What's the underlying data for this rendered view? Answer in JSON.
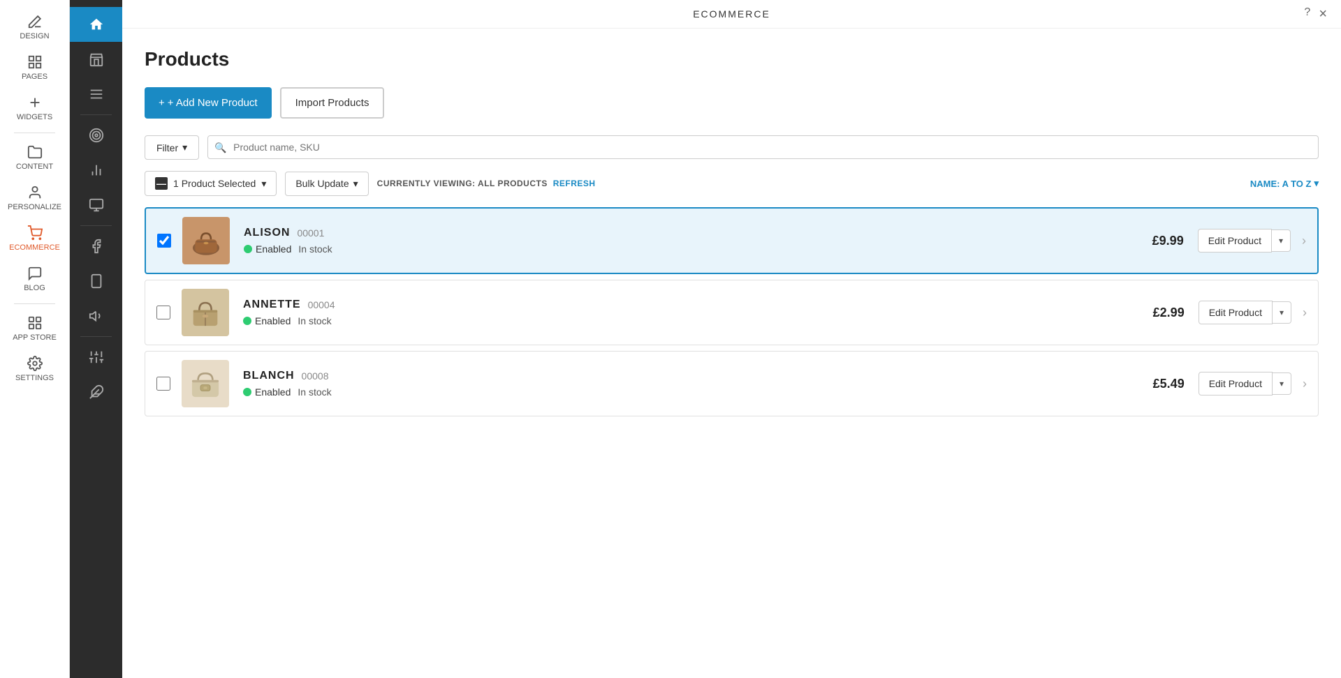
{
  "app_title": "ECOMMERCE",
  "far_left_sidebar": {
    "items": [
      {
        "id": "design",
        "label": "DESIGN",
        "icon": "pencil-icon",
        "active": false
      },
      {
        "id": "pages",
        "label": "PAGES",
        "icon": "pages-icon",
        "active": false
      },
      {
        "id": "widgets",
        "label": "WIDGETS",
        "icon": "plus-icon",
        "active": false
      },
      {
        "id": "content",
        "label": "CONTENT",
        "icon": "folder-icon",
        "active": false
      },
      {
        "id": "personalize",
        "label": "PERSONALIZE",
        "icon": "person-icon",
        "active": false
      },
      {
        "id": "ecommerce",
        "label": "ECOMMERCE",
        "icon": "cart-icon",
        "active": true
      },
      {
        "id": "blog",
        "label": "BLOG",
        "icon": "chat-icon",
        "active": false
      },
      {
        "id": "app-store",
        "label": "APP STORE",
        "icon": "puzzle-icon",
        "active": false
      },
      {
        "id": "settings",
        "label": "SETTINGS",
        "icon": "gear-icon",
        "active": false
      }
    ]
  },
  "inner_sidebar": {
    "items": [
      {
        "id": "home",
        "icon": "home-icon",
        "active": true
      },
      {
        "id": "store",
        "icon": "store-icon",
        "active": false
      },
      {
        "id": "menu",
        "icon": "menu-icon",
        "active": false
      },
      {
        "id": "target",
        "icon": "target-icon",
        "active": false
      },
      {
        "id": "chart",
        "icon": "chart-icon",
        "active": false
      },
      {
        "id": "orders",
        "icon": "orders-icon",
        "active": false
      },
      {
        "id": "social",
        "icon": "social-icon",
        "active": false
      },
      {
        "id": "mobile",
        "icon": "mobile-icon",
        "active": false
      },
      {
        "id": "megaphone",
        "icon": "megaphone-icon",
        "active": false
      },
      {
        "id": "extensions",
        "icon": "extensions-icon",
        "active": false
      },
      {
        "id": "sliders",
        "icon": "sliders-icon",
        "active": false
      },
      {
        "id": "puzzle2",
        "icon": "puzzle2-icon",
        "active": false
      }
    ]
  },
  "header": {
    "title": "ECOMMERCE",
    "help_icon": "?",
    "close_icon": "×"
  },
  "products_page": {
    "title": "Products",
    "add_button_label": "+ Add New Product",
    "import_button_label": "Import Products",
    "filter": {
      "button_label": "Filter",
      "search_placeholder": "Product name, SKU"
    },
    "selection_bar": {
      "minus_symbol": "—",
      "selected_count": "1",
      "selected_label": "Product Selected",
      "bulk_update_label": "Bulk Update",
      "viewing_text": "CURRENTLY VIEWING: ALL PRODUCTS",
      "refresh_label": "REFRESH",
      "sort_label": "NAME: A TO Z"
    },
    "products": [
      {
        "id": "alison",
        "name": "ALISON",
        "sku": "00001",
        "status": "Enabled",
        "stock": "In stock",
        "price": "£9.99",
        "selected": true,
        "edit_label": "Edit Product",
        "color": "#d4a87a"
      },
      {
        "id": "annette",
        "name": "ANNETTE",
        "sku": "00004",
        "status": "Enabled",
        "stock": "In stock",
        "price": "£2.99",
        "selected": false,
        "edit_label": "Edit Product",
        "color": "#c8b89a"
      },
      {
        "id": "blanch",
        "name": "BLANCH",
        "sku": "00008",
        "status": "Enabled",
        "stock": "In stock",
        "price": "£5.49",
        "selected": false,
        "edit_label": "Edit Product",
        "color": "#e8dcc8"
      }
    ]
  }
}
